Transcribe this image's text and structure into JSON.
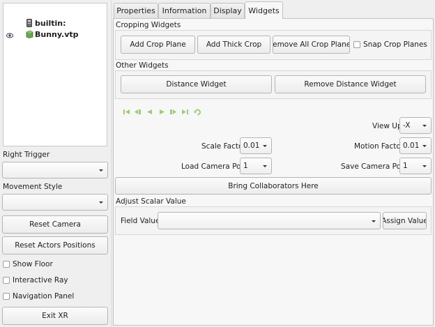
{
  "tree": {
    "root_label": "builtin:",
    "child_label": "Bunny.vtp"
  },
  "left": {
    "right_trigger_label": "Right Trigger",
    "right_trigger_value": "",
    "movement_style_label": "Movement Style",
    "movement_style_value": "",
    "reset_camera": "Reset Camera",
    "reset_actors": "Reset Actors Positions",
    "show_floor": "Show Floor",
    "interactive_ray": "Interactive Ray",
    "navigation_panel": "Navigation Panel",
    "exit_xr": "Exit XR"
  },
  "tabs": [
    "Properties",
    "Information",
    "Display",
    "Widgets"
  ],
  "cropping": {
    "title": "Cropping Widgets",
    "add_crop_plane": "Add Crop Plane",
    "add_thick_crop": "Add Thick Crop",
    "remove_all": "Remove All Crop Planes",
    "snap": "Snap Crop Planes"
  },
  "other": {
    "title": "Other Widgets",
    "distance_widget": "Distance Widget",
    "remove_distance": "Remove Distance Widget"
  },
  "camera": {
    "view_up_label": "View Up",
    "view_up_value": "-X",
    "scale_factor_label": "Scale Factor",
    "scale_factor_value": "0.01",
    "motion_factor_label": "Motion Factor",
    "motion_factor_value": "0.01",
    "load_pose_label": "Load Camera Pose",
    "load_pose_value": "1",
    "save_pose_label": "Save Camera Pose",
    "save_pose_value": "1",
    "bring_collaborators": "Bring Collaborators Here"
  },
  "scalar": {
    "title": "Adjust Scalar Value",
    "field_value_label": "Field Value",
    "field_value": "",
    "assign_value": "Assign Value"
  },
  "colors": {
    "media_green": "#8fbc5a",
    "accent_blue": "#3a6ea5"
  }
}
